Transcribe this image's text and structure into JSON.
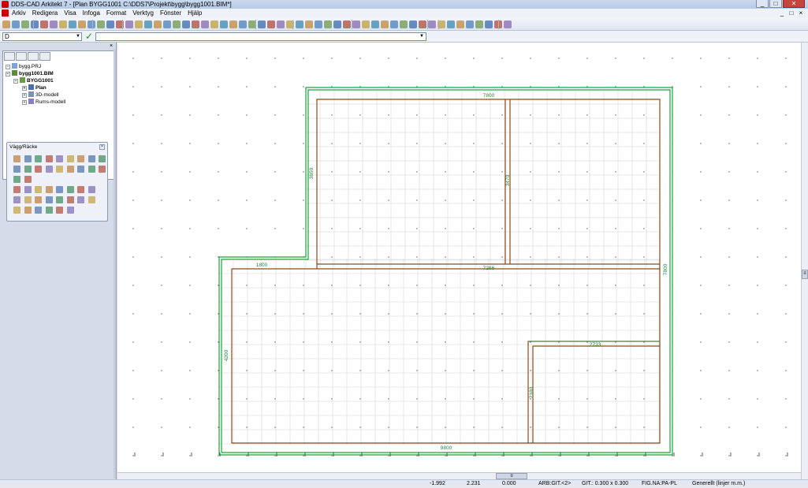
{
  "window": {
    "title": "DDS-CAD Arkitekt 7 - [Plan  BYGG1001  C:\\DDS7\\Projekt\\bygg\\bygg1001.BIM*]",
    "controls": [
      "_",
      "□",
      "✕"
    ]
  },
  "menu": {
    "items": [
      "Arkiv",
      "Redigera",
      "Visa",
      "Infoga",
      "Format",
      "Verktyg",
      "Fönster",
      "Hjälp"
    ],
    "mdi_controls": [
      "_",
      "□",
      "×"
    ]
  },
  "commandbar": {
    "layer_value": "D",
    "ok_symbol": "✓",
    "command_value": ""
  },
  "tree": {
    "close_symbol": "×",
    "nodes": [
      {
        "label": "bygg.PRJ",
        "level": 0
      },
      {
        "label": "bygg1001.BIM",
        "level": 0
      },
      {
        "label": "BYGG1001",
        "level": 1
      },
      {
        "label": "Plan",
        "level": 2
      },
      {
        "label": "3D-modell",
        "level": 2
      },
      {
        "label": "Rums-modell",
        "level": 2
      }
    ]
  },
  "palette": {
    "title": "Vägg/Räcke",
    "close_symbol": "×"
  },
  "drawing": {
    "colors": {
      "wall": "#8b4a1c",
      "outer_line": "#1aa33a",
      "dimension": "#1f8a3a",
      "grid": "#cfcfcf"
    },
    "dimensions": [
      "7800",
      "3650",
      "3470",
      "1800",
      "7266",
      "7800",
      "4200",
      "2733",
      "2180",
      "9800"
    ]
  },
  "scrollbars": {
    "v_thumb_symbol": "≡",
    "h_thumb_symbol": "≡"
  },
  "statusbar": {
    "x": "-1.992",
    "y": "2.231",
    "z": "0.000",
    "arb": "ARB:GIT.<2>",
    "git": "GIT.: 0.300 x 0.300",
    "fig": "FIG.NA:PA-PL",
    "mode": "Generellt (linjer m.m.)"
  }
}
